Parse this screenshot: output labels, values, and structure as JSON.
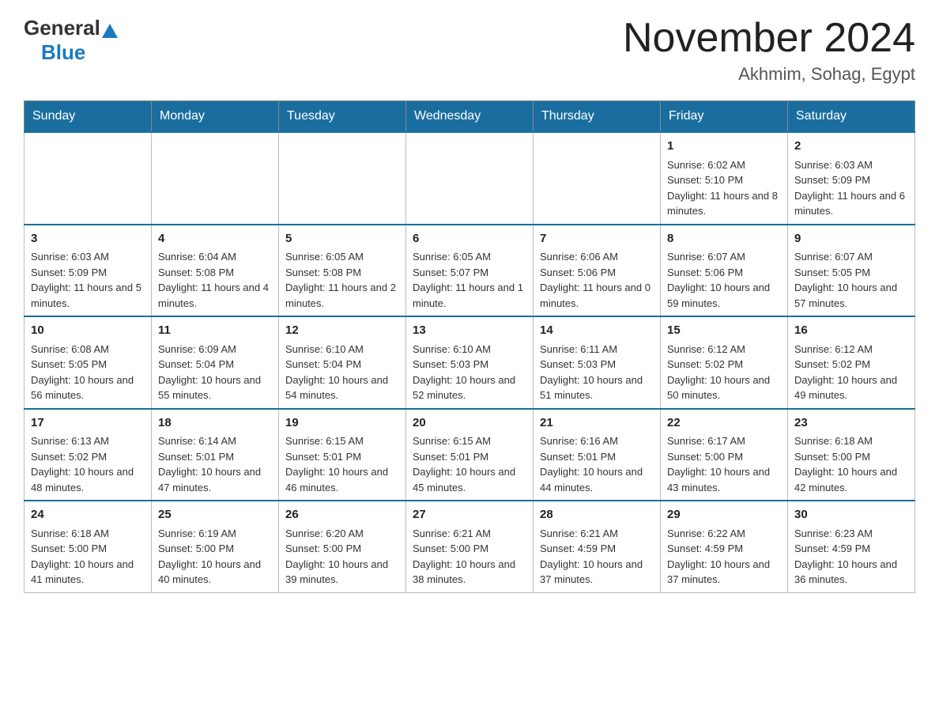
{
  "header": {
    "logo_general": "General",
    "logo_blue": "Blue",
    "month": "November 2024",
    "location": "Akhmim, Sohag, Egypt"
  },
  "days_of_week": [
    "Sunday",
    "Monday",
    "Tuesday",
    "Wednesday",
    "Thursday",
    "Friday",
    "Saturday"
  ],
  "weeks": [
    [
      {
        "day": "",
        "info": ""
      },
      {
        "day": "",
        "info": ""
      },
      {
        "day": "",
        "info": ""
      },
      {
        "day": "",
        "info": ""
      },
      {
        "day": "",
        "info": ""
      },
      {
        "day": "1",
        "info": "Sunrise: 6:02 AM\nSunset: 5:10 PM\nDaylight: 11 hours and 8 minutes."
      },
      {
        "day": "2",
        "info": "Sunrise: 6:03 AM\nSunset: 5:09 PM\nDaylight: 11 hours and 6 minutes."
      }
    ],
    [
      {
        "day": "3",
        "info": "Sunrise: 6:03 AM\nSunset: 5:09 PM\nDaylight: 11 hours and 5 minutes."
      },
      {
        "day": "4",
        "info": "Sunrise: 6:04 AM\nSunset: 5:08 PM\nDaylight: 11 hours and 4 minutes."
      },
      {
        "day": "5",
        "info": "Sunrise: 6:05 AM\nSunset: 5:08 PM\nDaylight: 11 hours and 2 minutes."
      },
      {
        "day": "6",
        "info": "Sunrise: 6:05 AM\nSunset: 5:07 PM\nDaylight: 11 hours and 1 minute."
      },
      {
        "day": "7",
        "info": "Sunrise: 6:06 AM\nSunset: 5:06 PM\nDaylight: 11 hours and 0 minutes."
      },
      {
        "day": "8",
        "info": "Sunrise: 6:07 AM\nSunset: 5:06 PM\nDaylight: 10 hours and 59 minutes."
      },
      {
        "day": "9",
        "info": "Sunrise: 6:07 AM\nSunset: 5:05 PM\nDaylight: 10 hours and 57 minutes."
      }
    ],
    [
      {
        "day": "10",
        "info": "Sunrise: 6:08 AM\nSunset: 5:05 PM\nDaylight: 10 hours and 56 minutes."
      },
      {
        "day": "11",
        "info": "Sunrise: 6:09 AM\nSunset: 5:04 PM\nDaylight: 10 hours and 55 minutes."
      },
      {
        "day": "12",
        "info": "Sunrise: 6:10 AM\nSunset: 5:04 PM\nDaylight: 10 hours and 54 minutes."
      },
      {
        "day": "13",
        "info": "Sunrise: 6:10 AM\nSunset: 5:03 PM\nDaylight: 10 hours and 52 minutes."
      },
      {
        "day": "14",
        "info": "Sunrise: 6:11 AM\nSunset: 5:03 PM\nDaylight: 10 hours and 51 minutes."
      },
      {
        "day": "15",
        "info": "Sunrise: 6:12 AM\nSunset: 5:02 PM\nDaylight: 10 hours and 50 minutes."
      },
      {
        "day": "16",
        "info": "Sunrise: 6:12 AM\nSunset: 5:02 PM\nDaylight: 10 hours and 49 minutes."
      }
    ],
    [
      {
        "day": "17",
        "info": "Sunrise: 6:13 AM\nSunset: 5:02 PM\nDaylight: 10 hours and 48 minutes."
      },
      {
        "day": "18",
        "info": "Sunrise: 6:14 AM\nSunset: 5:01 PM\nDaylight: 10 hours and 47 minutes."
      },
      {
        "day": "19",
        "info": "Sunrise: 6:15 AM\nSunset: 5:01 PM\nDaylight: 10 hours and 46 minutes."
      },
      {
        "day": "20",
        "info": "Sunrise: 6:15 AM\nSunset: 5:01 PM\nDaylight: 10 hours and 45 minutes."
      },
      {
        "day": "21",
        "info": "Sunrise: 6:16 AM\nSunset: 5:01 PM\nDaylight: 10 hours and 44 minutes."
      },
      {
        "day": "22",
        "info": "Sunrise: 6:17 AM\nSunset: 5:00 PM\nDaylight: 10 hours and 43 minutes."
      },
      {
        "day": "23",
        "info": "Sunrise: 6:18 AM\nSunset: 5:00 PM\nDaylight: 10 hours and 42 minutes."
      }
    ],
    [
      {
        "day": "24",
        "info": "Sunrise: 6:18 AM\nSunset: 5:00 PM\nDaylight: 10 hours and 41 minutes."
      },
      {
        "day": "25",
        "info": "Sunrise: 6:19 AM\nSunset: 5:00 PM\nDaylight: 10 hours and 40 minutes."
      },
      {
        "day": "26",
        "info": "Sunrise: 6:20 AM\nSunset: 5:00 PM\nDaylight: 10 hours and 39 minutes."
      },
      {
        "day": "27",
        "info": "Sunrise: 6:21 AM\nSunset: 5:00 PM\nDaylight: 10 hours and 38 minutes."
      },
      {
        "day": "28",
        "info": "Sunrise: 6:21 AM\nSunset: 4:59 PM\nDaylight: 10 hours and 37 minutes."
      },
      {
        "day": "29",
        "info": "Sunrise: 6:22 AM\nSunset: 4:59 PM\nDaylight: 10 hours and 37 minutes."
      },
      {
        "day": "30",
        "info": "Sunrise: 6:23 AM\nSunset: 4:59 PM\nDaylight: 10 hours and 36 minutes."
      }
    ]
  ]
}
